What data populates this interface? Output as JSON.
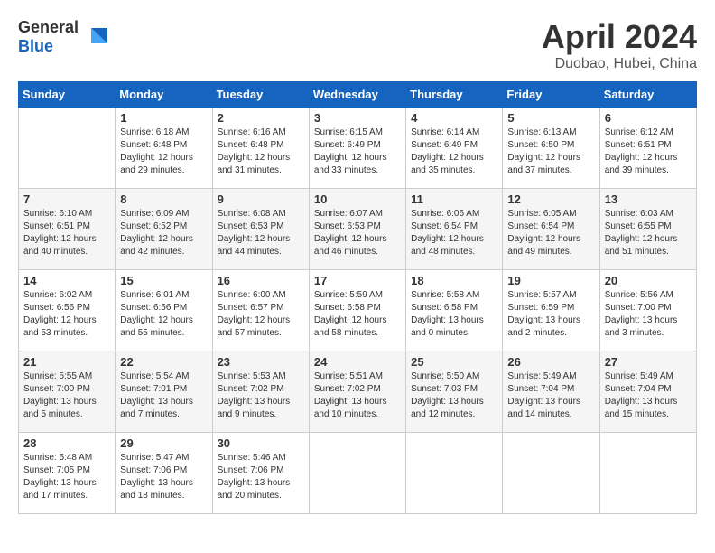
{
  "header": {
    "logo_general": "General",
    "logo_blue": "Blue",
    "title": "April 2024",
    "subtitle": "Duobao, Hubei, China"
  },
  "calendar": {
    "days_of_week": [
      "Sunday",
      "Monday",
      "Tuesday",
      "Wednesday",
      "Thursday",
      "Friday",
      "Saturday"
    ],
    "weeks": [
      [
        {
          "day": "",
          "info": ""
        },
        {
          "day": "1",
          "info": "Sunrise: 6:18 AM\nSunset: 6:48 PM\nDaylight: 12 hours\nand 29 minutes."
        },
        {
          "day": "2",
          "info": "Sunrise: 6:16 AM\nSunset: 6:48 PM\nDaylight: 12 hours\nand 31 minutes."
        },
        {
          "day": "3",
          "info": "Sunrise: 6:15 AM\nSunset: 6:49 PM\nDaylight: 12 hours\nand 33 minutes."
        },
        {
          "day": "4",
          "info": "Sunrise: 6:14 AM\nSunset: 6:49 PM\nDaylight: 12 hours\nand 35 minutes."
        },
        {
          "day": "5",
          "info": "Sunrise: 6:13 AM\nSunset: 6:50 PM\nDaylight: 12 hours\nand 37 minutes."
        },
        {
          "day": "6",
          "info": "Sunrise: 6:12 AM\nSunset: 6:51 PM\nDaylight: 12 hours\nand 39 minutes."
        }
      ],
      [
        {
          "day": "7",
          "info": "Sunrise: 6:10 AM\nSunset: 6:51 PM\nDaylight: 12 hours\nand 40 minutes."
        },
        {
          "day": "8",
          "info": "Sunrise: 6:09 AM\nSunset: 6:52 PM\nDaylight: 12 hours\nand 42 minutes."
        },
        {
          "day": "9",
          "info": "Sunrise: 6:08 AM\nSunset: 6:53 PM\nDaylight: 12 hours\nand 44 minutes."
        },
        {
          "day": "10",
          "info": "Sunrise: 6:07 AM\nSunset: 6:53 PM\nDaylight: 12 hours\nand 46 minutes."
        },
        {
          "day": "11",
          "info": "Sunrise: 6:06 AM\nSunset: 6:54 PM\nDaylight: 12 hours\nand 48 minutes."
        },
        {
          "day": "12",
          "info": "Sunrise: 6:05 AM\nSunset: 6:54 PM\nDaylight: 12 hours\nand 49 minutes."
        },
        {
          "day": "13",
          "info": "Sunrise: 6:03 AM\nSunset: 6:55 PM\nDaylight: 12 hours\nand 51 minutes."
        }
      ],
      [
        {
          "day": "14",
          "info": "Sunrise: 6:02 AM\nSunset: 6:56 PM\nDaylight: 12 hours\nand 53 minutes."
        },
        {
          "day": "15",
          "info": "Sunrise: 6:01 AM\nSunset: 6:56 PM\nDaylight: 12 hours\nand 55 minutes."
        },
        {
          "day": "16",
          "info": "Sunrise: 6:00 AM\nSunset: 6:57 PM\nDaylight: 12 hours\nand 57 minutes."
        },
        {
          "day": "17",
          "info": "Sunrise: 5:59 AM\nSunset: 6:58 PM\nDaylight: 12 hours\nand 58 minutes."
        },
        {
          "day": "18",
          "info": "Sunrise: 5:58 AM\nSunset: 6:58 PM\nDaylight: 13 hours\nand 0 minutes."
        },
        {
          "day": "19",
          "info": "Sunrise: 5:57 AM\nSunset: 6:59 PM\nDaylight: 13 hours\nand 2 minutes."
        },
        {
          "day": "20",
          "info": "Sunrise: 5:56 AM\nSunset: 7:00 PM\nDaylight: 13 hours\nand 3 minutes."
        }
      ],
      [
        {
          "day": "21",
          "info": "Sunrise: 5:55 AM\nSunset: 7:00 PM\nDaylight: 13 hours\nand 5 minutes."
        },
        {
          "day": "22",
          "info": "Sunrise: 5:54 AM\nSunset: 7:01 PM\nDaylight: 13 hours\nand 7 minutes."
        },
        {
          "day": "23",
          "info": "Sunrise: 5:53 AM\nSunset: 7:02 PM\nDaylight: 13 hours\nand 9 minutes."
        },
        {
          "day": "24",
          "info": "Sunrise: 5:51 AM\nSunset: 7:02 PM\nDaylight: 13 hours\nand 10 minutes."
        },
        {
          "day": "25",
          "info": "Sunrise: 5:50 AM\nSunset: 7:03 PM\nDaylight: 13 hours\nand 12 minutes."
        },
        {
          "day": "26",
          "info": "Sunrise: 5:49 AM\nSunset: 7:04 PM\nDaylight: 13 hours\nand 14 minutes."
        },
        {
          "day": "27",
          "info": "Sunrise: 5:49 AM\nSunset: 7:04 PM\nDaylight: 13 hours\nand 15 minutes."
        }
      ],
      [
        {
          "day": "28",
          "info": "Sunrise: 5:48 AM\nSunset: 7:05 PM\nDaylight: 13 hours\nand 17 minutes."
        },
        {
          "day": "29",
          "info": "Sunrise: 5:47 AM\nSunset: 7:06 PM\nDaylight: 13 hours\nand 18 minutes."
        },
        {
          "day": "30",
          "info": "Sunrise: 5:46 AM\nSunset: 7:06 PM\nDaylight: 13 hours\nand 20 minutes."
        },
        {
          "day": "",
          "info": ""
        },
        {
          "day": "",
          "info": ""
        },
        {
          "day": "",
          "info": ""
        },
        {
          "day": "",
          "info": ""
        }
      ]
    ]
  }
}
